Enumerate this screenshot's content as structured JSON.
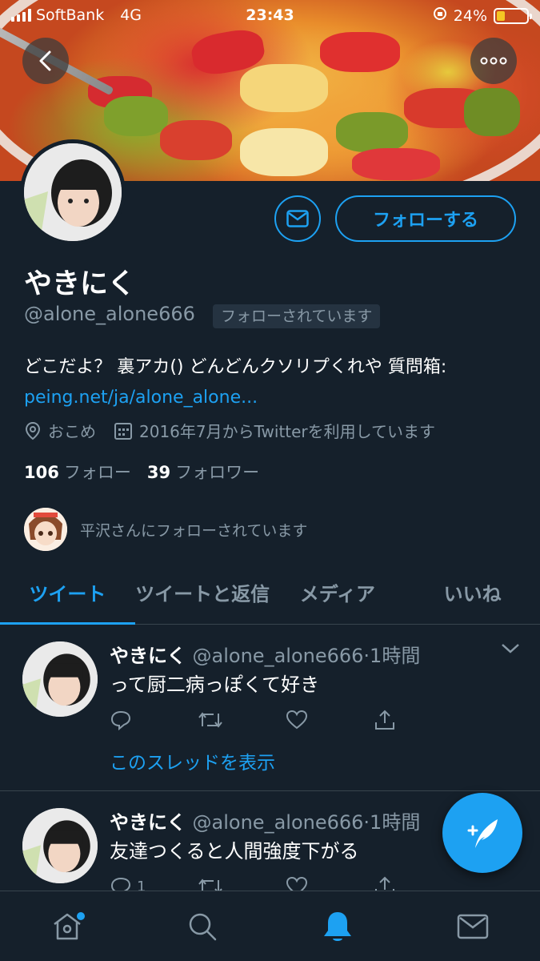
{
  "status_bar": {
    "carrier": "SoftBank",
    "network": "4G",
    "time": "23:43",
    "battery": "24%",
    "battery_level": 0.24
  },
  "profile": {
    "name": "やきにく",
    "handle": "@alone_alone666",
    "follows_you": "フォローされています",
    "follow_button": "フォローする",
    "bio_text": "どこだよ？ 裏アカ() どんどんクソリプくれや 質問箱:",
    "bio_link": "peing.net/ja/alone_alone...",
    "location": "おこめ",
    "joined": "2016年7月からTwitterを利用しています",
    "following_count": "106",
    "following_label": "フォロー",
    "followers_count": "39",
    "followers_label": "フォロワー",
    "followed_by": "平沢さんにフォローされています"
  },
  "tabs": [
    {
      "label": "ツイート",
      "active": true
    },
    {
      "label": "ツイートと返信",
      "active": false
    },
    {
      "label": "メディア",
      "active": false
    },
    {
      "label": "いいね",
      "active": false
    }
  ],
  "tweets": [
    {
      "name": "やきにく",
      "handle": "@alone_alone666",
      "time": "·1時間",
      "text": "って厨二病っぽくて好き",
      "thread_link": "このスレッドを表示",
      "reply_count": ""
    },
    {
      "name": "やきにく",
      "handle": "@alone_alone666",
      "time": "·1時間",
      "text": "友達つくると人間強度下がる",
      "reply_count": "1"
    }
  ],
  "colors": {
    "background": "#15202b",
    "accent": "#1da1f2",
    "secondary_text": "#8899a6",
    "divider": "#38444d"
  },
  "icons": {
    "back": "chevron-left-icon",
    "more": "more-icon",
    "message": "envelope-icon",
    "location": "location-pin-icon",
    "calendar": "calendar-icon",
    "compose": "compose-tweet-icon",
    "nav": [
      "home-icon",
      "search-icon",
      "notifications-icon",
      "messages-icon"
    ]
  }
}
